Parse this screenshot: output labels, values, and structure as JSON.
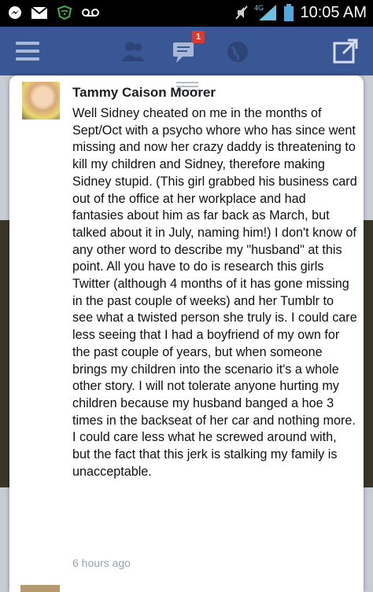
{
  "status_bar": {
    "time": "10:05 AM",
    "network": "4G"
  },
  "app_bar": {
    "notification_count": "1"
  },
  "post": {
    "author": "Tammy Caison Moorer",
    "text": "Well Sidney cheated on me in the months of Sept/Oct with a psycho whore who has since went missing and now her crazy daddy is threatening to kill my children and Sidney, therefore making Sidney stupid. (This girl grabbed his business card out of the office at her workplace and had fantasies about him as far back as March, but talked about it in July, naming him!) I don't know of any other word to describe my \"husband\" at this point. All you have to do is research this girls Twitter (although 4 months of it has gone missing in the past couple of weeks) and her Tumblr to see what a twisted person she truly is. I could care less seeing that I had a boyfriend of my own for the past couple of years, but when someone brings my children into the scenario it's a whole other story. I will not tolerate anyone hurting my children because my husband banged a hoe 3 times in the backseat of her car and nothing more. I could care less what he screwed around with, but the fact that this jerk is stalking my family is unacceptable.",
    "timestamp": "6 hours ago"
  },
  "colors": {
    "facebook_blue": "#3a5795",
    "badge_red": "#e0392b"
  }
}
